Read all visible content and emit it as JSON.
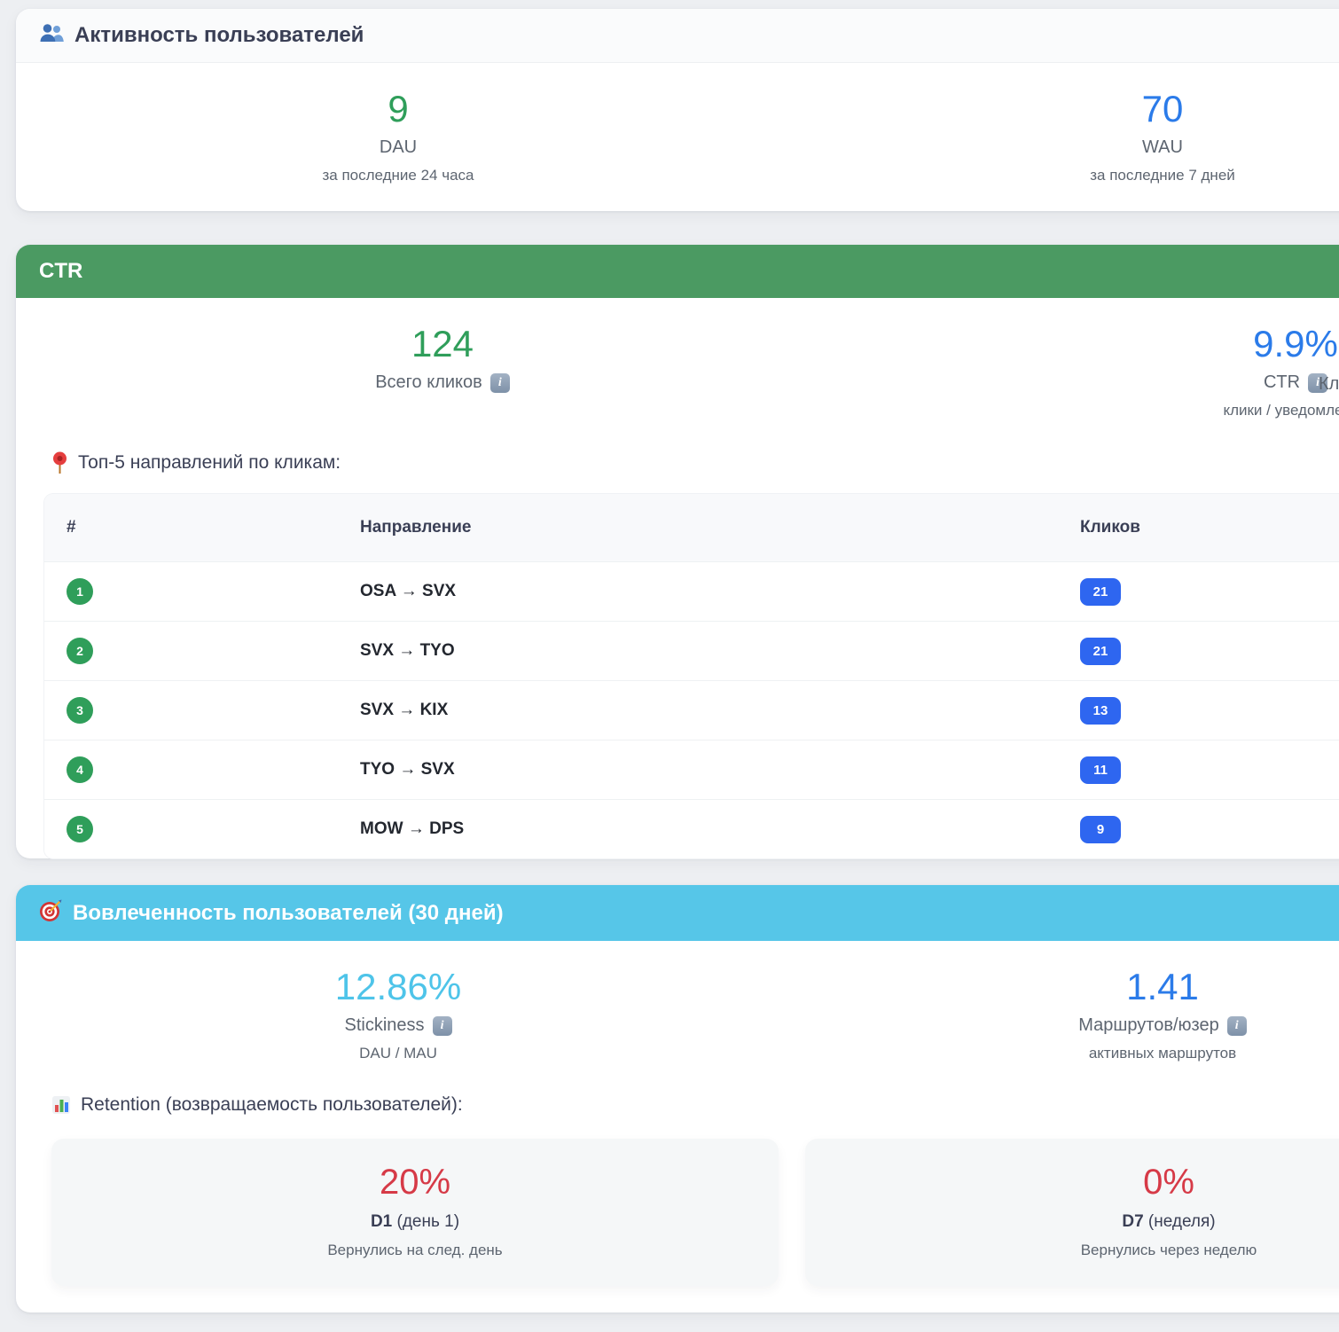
{
  "colors": {
    "green": "#2f9e5a",
    "blue": "#2b7be9",
    "lightblue": "#4ec4e9",
    "red": "#d63a47",
    "badge": "#2e66f0",
    "header-green": "#4b9a62",
    "header-blue": "#56c6e8"
  },
  "icons": {
    "info_glyph": "i"
  },
  "activity_card": {
    "title": "Активность пользователей",
    "metrics": [
      {
        "value": "9",
        "label": "DAU",
        "sub": "за последние 24 часа"
      },
      {
        "value": "70",
        "label": "WAU",
        "sub": "за последние 7 дней"
      }
    ]
  },
  "ctr_card": {
    "title": "CTR",
    "metrics": [
      {
        "value": "124",
        "label": "Всего кликов",
        "sub": ""
      },
      {
        "value": "9.9%",
        "label": "CTR",
        "sub": "клики / уведомления"
      }
    ],
    "partial_metric_label": "Кл",
    "top5_heading": "Топ-5 направлений по кликам:",
    "table": {
      "headers": [
        "#",
        "Направление",
        "Кликов"
      ],
      "rows": [
        {
          "rank": "1",
          "route": "OSA → SVX",
          "clicks": "21"
        },
        {
          "rank": "2",
          "route": "SVX → TYO",
          "clicks": "21"
        },
        {
          "rank": "3",
          "route": "SVX → KIX",
          "clicks": "13"
        },
        {
          "rank": "4",
          "route": "TYO → SVX",
          "clicks": "11"
        },
        {
          "rank": "5",
          "route": "MOW → DPS",
          "clicks": "9"
        }
      ]
    }
  },
  "engagement_card": {
    "title": "Вовлеченность пользователей (30 дней)",
    "metrics": [
      {
        "value": "12.86%",
        "label": "Stickiness",
        "sub": "DAU / MAU"
      },
      {
        "value": "1.41",
        "label": "Маршрутов/юзер",
        "sub": "активных маршрутов"
      }
    ],
    "retention_heading": "Retention (возвращаемость пользователей):",
    "retention": [
      {
        "value": "20%",
        "label_bold": "D1",
        "label_rest": " (день 1)",
        "sub": "Вернулись на след. день"
      },
      {
        "value": "0%",
        "label_bold": "D7",
        "label_rest": " (неделя)",
        "sub": "Вернулись через неделю"
      }
    ]
  }
}
